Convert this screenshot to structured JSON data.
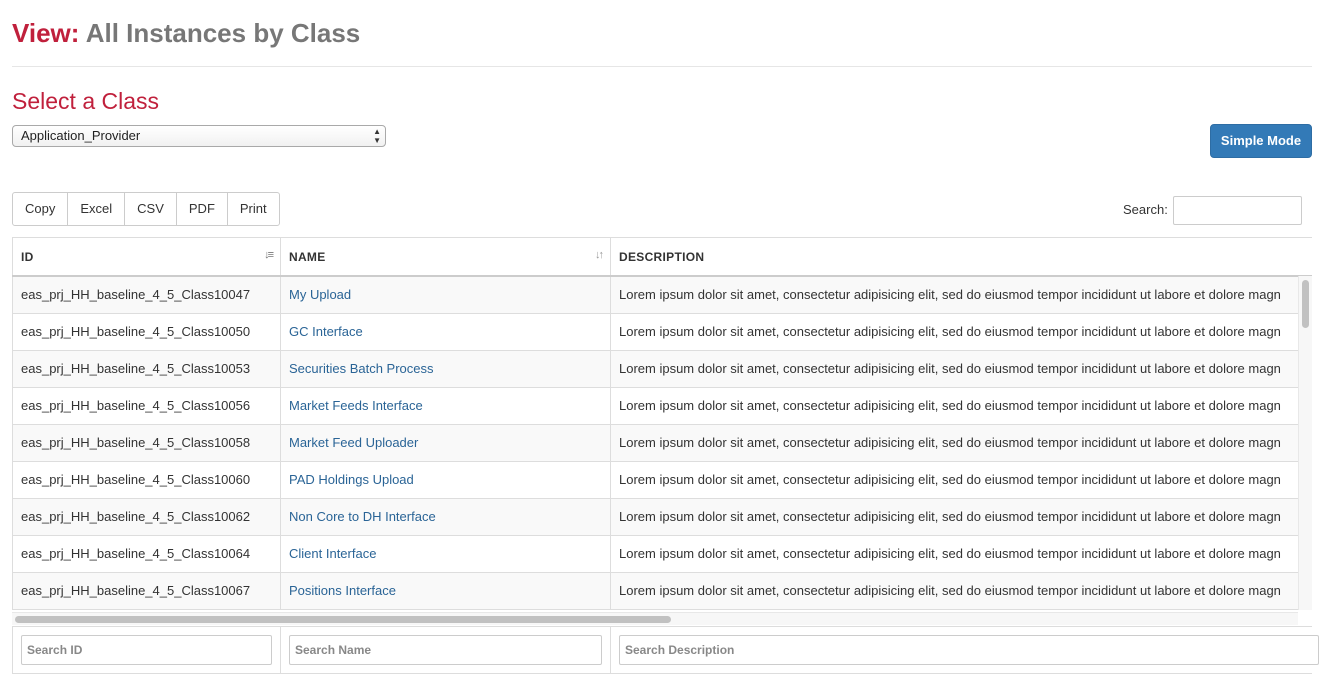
{
  "header": {
    "title_prefix": "View:",
    "title_rest": "All Instances by Class"
  },
  "selector": {
    "heading": "Select a Class",
    "selected_value": "Application_Provider"
  },
  "actions": {
    "simple_mode_label": "Simple Mode"
  },
  "export_buttons": [
    "Copy",
    "Excel",
    "CSV",
    "PDF",
    "Print"
  ],
  "search": {
    "label": "Search:",
    "value": ""
  },
  "table": {
    "columns": [
      "ID",
      "NAME",
      "DESCRIPTION"
    ],
    "rows": [
      {
        "id": "eas_prj_HH_baseline_4_5_Class10047",
        "name": "My Upload",
        "description": "Lorem ipsum dolor sit amet, consectetur adipisicing elit, sed do eiusmod tempor incididunt ut labore et dolore magn"
      },
      {
        "id": "eas_prj_HH_baseline_4_5_Class10050",
        "name": "GC Interface",
        "description": "Lorem ipsum dolor sit amet, consectetur adipisicing elit, sed do eiusmod tempor incididunt ut labore et dolore magn"
      },
      {
        "id": "eas_prj_HH_baseline_4_5_Class10053",
        "name": "Securities Batch Process",
        "description": "Lorem ipsum dolor sit amet, consectetur adipisicing elit, sed do eiusmod tempor incididunt ut labore et dolore magn"
      },
      {
        "id": "eas_prj_HH_baseline_4_5_Class10056",
        "name": "Market Feeds Interface",
        "description": "Lorem ipsum dolor sit amet, consectetur adipisicing elit, sed do eiusmod tempor incididunt ut labore et dolore magn"
      },
      {
        "id": "eas_prj_HH_baseline_4_5_Class10058",
        "name": "Market Feed Uploader",
        "description": "Lorem ipsum dolor sit amet, consectetur adipisicing elit, sed do eiusmod tempor incididunt ut labore et dolore magn"
      },
      {
        "id": "eas_prj_HH_baseline_4_5_Class10060",
        "name": "PAD Holdings Upload",
        "description": "Lorem ipsum dolor sit amet, consectetur adipisicing elit, sed do eiusmod tempor incididunt ut labore et dolore magn"
      },
      {
        "id": "eas_prj_HH_baseline_4_5_Class10062",
        "name": "Non Core to DH Interface",
        "description": "Lorem ipsum dolor sit amet, consectetur adipisicing elit, sed do eiusmod tempor incididunt ut labore et dolore magn"
      },
      {
        "id": "eas_prj_HH_baseline_4_5_Class10064",
        "name": "Client Interface",
        "description": "Lorem ipsum dolor sit amet, consectetur adipisicing elit, sed do eiusmod tempor incididunt ut labore et dolore magn"
      },
      {
        "id": "eas_prj_HH_baseline_4_5_Class10067",
        "name": "Positions Interface",
        "description": "Lorem ipsum dolor sit amet, consectetur adipisicing elit, sed do eiusmod tempor incididunt ut labore et dolore magn"
      }
    ]
  },
  "footer_filters": [
    "Search ID",
    "Search Name",
    "Search Description"
  ],
  "colors": {
    "accent": "#c0203c",
    "primary_button": "#337ab7",
    "link": "#2a6496"
  }
}
